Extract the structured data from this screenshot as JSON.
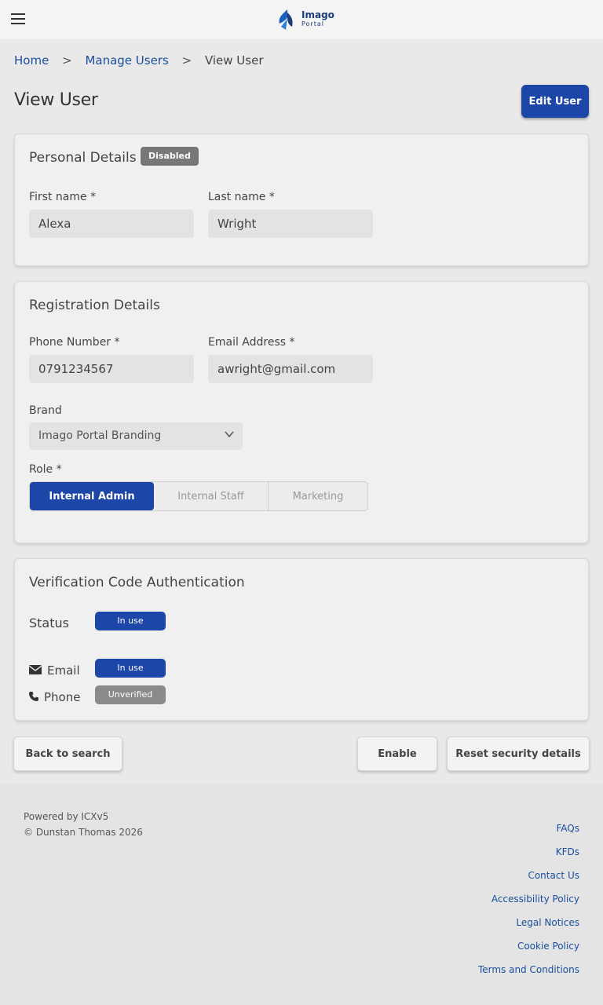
{
  "header": {
    "menu_icon": "hamburger-menu-icon",
    "logo_line1": "Imago",
    "logo_line2": "Portal"
  },
  "breadcrumb": {
    "home": "Home",
    "manage_users": "Manage Users",
    "current": "View User",
    "separator": ">"
  },
  "page": {
    "title": "View User",
    "edit_button": "Edit User"
  },
  "personal": {
    "title": "Personal Details",
    "status_badge": "Disabled",
    "first_name_label": "First name *",
    "first_name": "Alexa",
    "last_name_label": "Last name *",
    "last_name": "Wright"
  },
  "registration": {
    "title": "Registration Details",
    "phone_label": "Phone Number *",
    "phone": "0791234567",
    "email_label": "Email Address *",
    "email": "awright@gmail.com",
    "brand_label": "Brand",
    "brand": "Imago Portal Branding",
    "role_label": "Role *",
    "roles": [
      "Internal Admin",
      "Internal Staff",
      "Marketing"
    ],
    "selected_role": "Internal Admin"
  },
  "verification": {
    "title": "Verification Code Authentication",
    "status_label": "Status",
    "status_value": "In use",
    "email_label": "Email",
    "email_value": "In use",
    "phone_label": "Phone",
    "phone_value": "Unverified"
  },
  "actions": {
    "back": "Back to search",
    "enable": "Enable",
    "reset": "Reset security details"
  },
  "footer": {
    "powered_by": "Powered by ICXv5",
    "copyright": "© Dunstan Thomas 2026",
    "links": [
      "FAQs",
      "KFDs",
      "Contact Us",
      "Accessibility Policy",
      "Legal Notices",
      "Cookie Policy",
      "Terms and Conditions"
    ]
  },
  "colors": {
    "primary": "#1c47a8",
    "link": "#1a4fa0",
    "badge_grey": "#777777"
  }
}
